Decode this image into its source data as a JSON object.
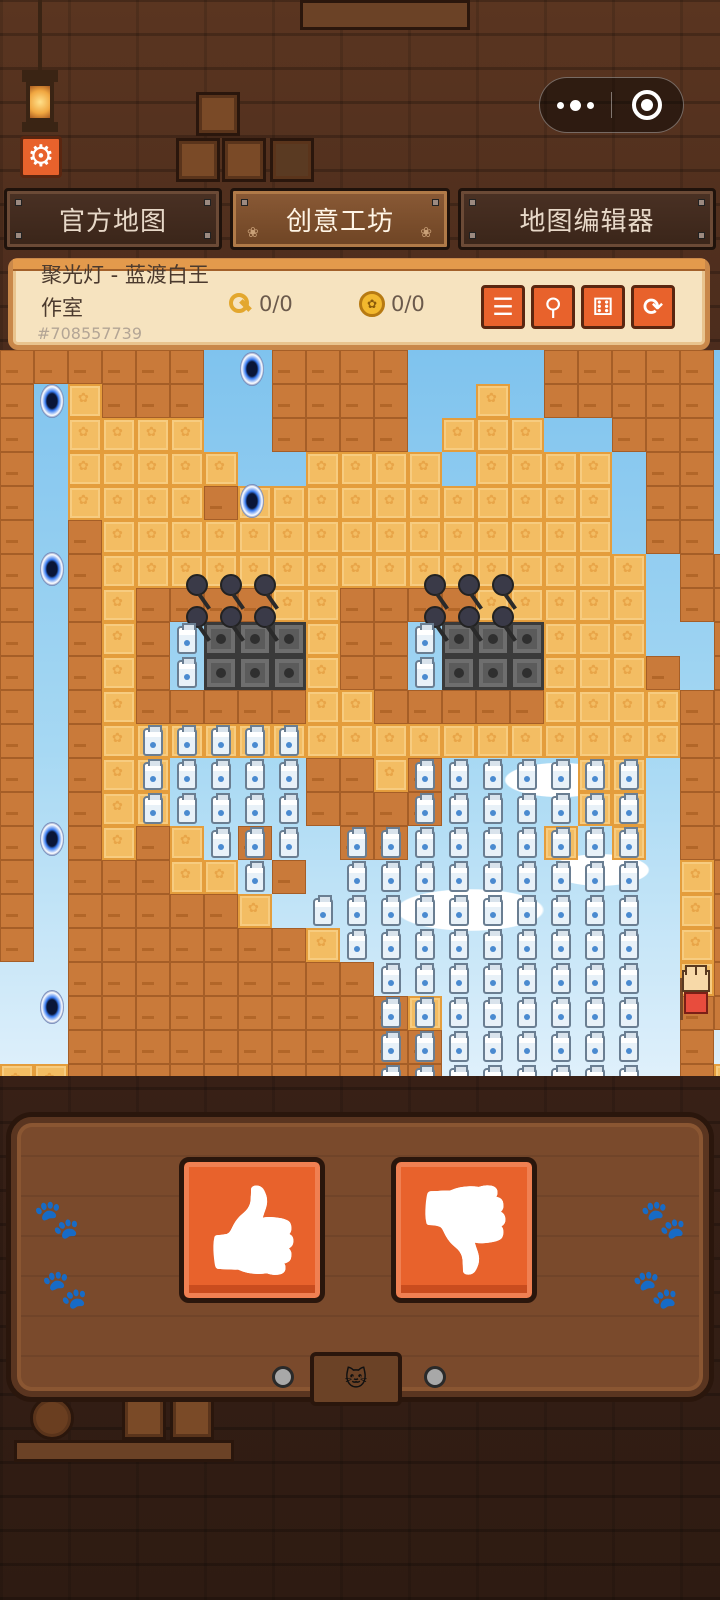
{
  "tabs": [
    {
      "label": "官方地图",
      "active": false
    },
    {
      "label": "创意工坊",
      "active": true
    },
    {
      "label": "地图编辑器",
      "active": false
    }
  ],
  "map": {
    "title_line1": "聚光灯 - 蓝渡白王",
    "title_line2": "作室",
    "map_id": "#708557739",
    "keys": "0/0",
    "coins": "0/0"
  },
  "icons": {
    "settings": "gear-icon",
    "menu": "menu-icon",
    "search": "search-icon",
    "random": "dice-icon",
    "restart": "refresh-icon",
    "like": "thumbs-up-icon",
    "dislike": "thumbs-down-icon"
  },
  "glyphs": {
    "gear": "⚙",
    "menu": "☰",
    "search": "⚲",
    "dice": "⚅",
    "refresh": "⟳",
    "thumb_up": "👍",
    "thumb_down": "👎",
    "paw": "🐾",
    "cat_face": "🐱"
  },
  "colors": {
    "accent": "#e8622c",
    "panel": "#f6e3bf",
    "wood": "#7a4a2c",
    "dirt": "#c97a3a",
    "sand": "#f3bd63",
    "sky": "#8fcbef"
  }
}
